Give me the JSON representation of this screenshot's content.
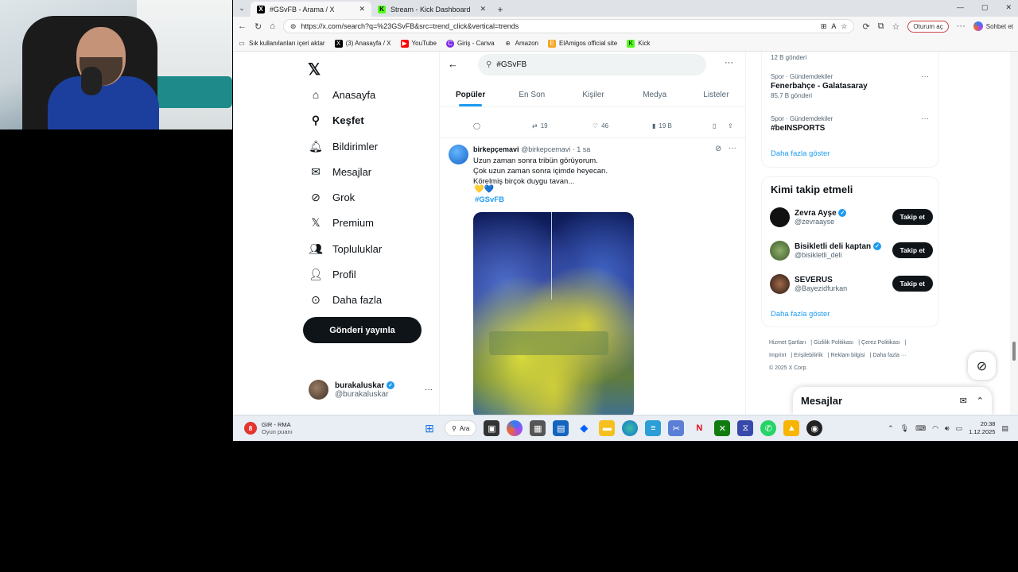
{
  "browser": {
    "tabs": [
      {
        "title": "#GSvFB - Arama / X",
        "favicon": "X",
        "active": true
      },
      {
        "title": "Stream - Kick Dashboard",
        "favicon": "K",
        "active": false
      }
    ],
    "url": "https://x.com/search?q=%23GSvFB&src=trend_click&vertical=trends",
    "signin_label": "Oturum aç",
    "chat_label": "Sohbet et",
    "bookmarks": [
      {
        "label": "Sık kullanılanları içeri aktar",
        "icon": "import-icon"
      },
      {
        "label": "(3) Anasayfa / X",
        "icon": "x-icon"
      },
      {
        "label": "YouTube",
        "icon": "youtube-icon"
      },
      {
        "label": "Giriş - Canva",
        "icon": "canva-icon"
      },
      {
        "label": "Amazon",
        "icon": "globe-icon"
      },
      {
        "label": "ElAmigos official site",
        "icon": "elamigos-icon"
      },
      {
        "label": "Kick",
        "icon": "kick-icon"
      }
    ]
  },
  "nav": {
    "items": [
      {
        "label": "Anasayfa",
        "icon": "home-icon"
      },
      {
        "label": "Keşfet",
        "icon": "search-icon"
      },
      {
        "label": "Bildirimler",
        "icon": "bell-icon"
      },
      {
        "label": "Mesajlar",
        "icon": "mail-icon"
      },
      {
        "label": "Grok",
        "icon": "grok-icon"
      },
      {
        "label": "Premium",
        "icon": "x-icon"
      },
      {
        "label": "Topluluklar",
        "icon": "people-icon"
      },
      {
        "label": "Profil",
        "icon": "person-icon"
      },
      {
        "label": "Daha fazla",
        "icon": "more-circle-icon"
      }
    ],
    "post_button": "Gönderi yayınla",
    "user": {
      "name": "burakaluskar",
      "handle": "@burakaluskar"
    }
  },
  "search": {
    "query": "#GSvFB",
    "tabs": [
      "Popüler",
      "En Son",
      "Kişiler",
      "Medya",
      "Listeler"
    ],
    "active_tab": "Popüler"
  },
  "prev_tweet_actions": {
    "retweets": "19",
    "likes": "46",
    "views": "19 B"
  },
  "tweet": {
    "name": "birkepçemavi",
    "handle": "@birkepcemavi",
    "time": "· 1 sa",
    "lines": [
      "Uzun zaman sonra tribün görüyorum.",
      "Çok uzun zaman sonra içimde heyecan.",
      "Körelmiş birçok duygu tavan..."
    ],
    "emoji": "💛💙",
    "hashtag": "#GSvFB"
  },
  "trends": {
    "top_count": "12 B gönderi",
    "items": [
      {
        "context": "Spor · Gündemdekiler",
        "name": "Fenerbahçe - Galatasaray",
        "count": "85,7 B gönderi"
      },
      {
        "context": "Spor · Gündemdekiler",
        "name": "#beINSPORTS",
        "count": ""
      }
    ],
    "show_more": "Daha fazla göster"
  },
  "who_to_follow": {
    "title": "Kimi takip etmeli",
    "follow_label": "Takip et",
    "users": [
      {
        "name": "Zevra Ayşe",
        "handle": "@zevraayse",
        "verified": true
      },
      {
        "name": "Bisikletli deli kaptan",
        "handle": "@bisikletli_deli",
        "verified": true
      },
      {
        "name": "SEVERUS",
        "handle": "@Bayezidfurkan",
        "verified": false
      }
    ],
    "show_more": "Daha fazla göster"
  },
  "footer": {
    "links": [
      "Hizmet Şartları",
      "Gizlilik Politikası",
      "Çerez Politikası",
      "Imprint",
      "Erişilebilirlik",
      "Reklam bilgisi",
      "Daha fazla ···"
    ],
    "copyright": "© 2025 X Corp."
  },
  "messages_dock": {
    "title": "Mesajlar"
  },
  "taskbar": {
    "weather_badge": "8",
    "line1": "GIR - RMA",
    "line2": "Oyun puanı",
    "search_label": "Ara",
    "time": "20:38",
    "date": "1.12.2025"
  }
}
